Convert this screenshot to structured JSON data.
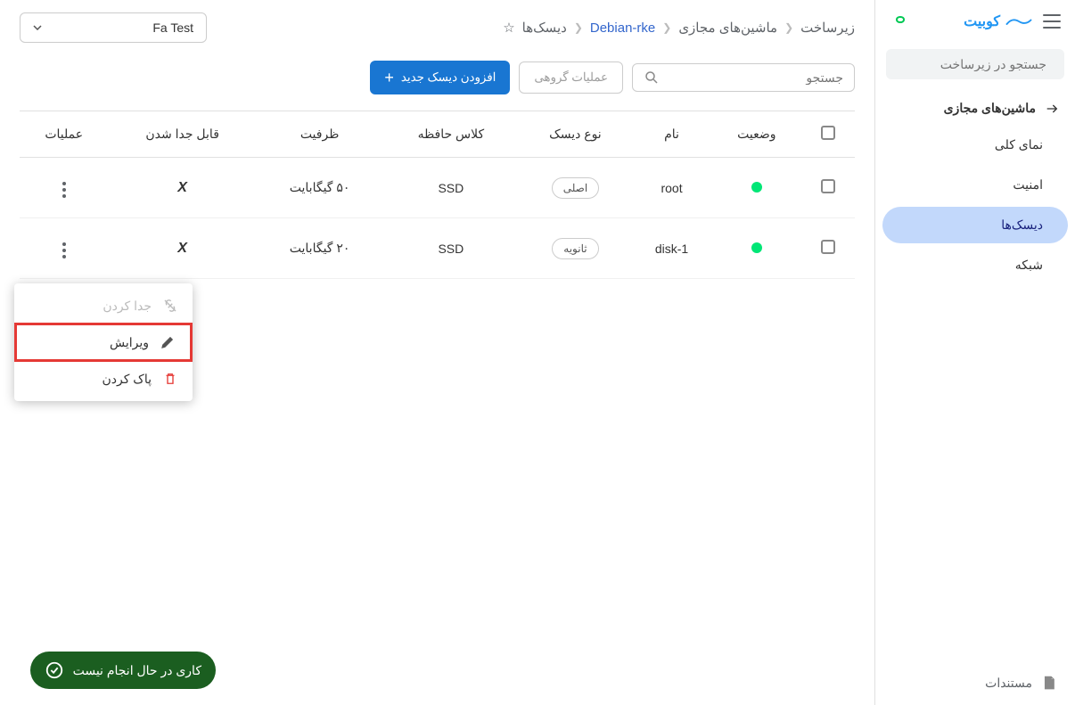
{
  "brand": {
    "name": "کوبیت"
  },
  "sidebar": {
    "search_placeholder": "جستجو در زیرساخت",
    "nav_title": "ماشین‌های مجازی",
    "items": [
      {
        "label": "نمای کلی"
      },
      {
        "label": "امنیت"
      },
      {
        "label": "دیسک‌ها"
      },
      {
        "label": "شبکه"
      }
    ],
    "docs": "مستندات"
  },
  "breadcrumb": {
    "c0": "زیرساخت",
    "c1": "ماشین‌های مجازی",
    "c2": "Debian-rke",
    "c3": "دیسک‌ها"
  },
  "project_selector": {
    "label": "Fa Test"
  },
  "toolbar": {
    "search_placeholder": "جستجو",
    "bulk_label": "عملیات گروهی",
    "add_label": "افزودن دیسک جدید"
  },
  "table": {
    "headers": {
      "checkbox": "",
      "status": "وضعیت",
      "name": "نام",
      "type": "نوع دیسک",
      "class": "کلاس حافظه",
      "capacity": "ظرفیت",
      "detachable": "قابل جدا شدن",
      "ops": "عملیات"
    },
    "rows": [
      {
        "name": "root",
        "type": "اصلی",
        "class": "SSD",
        "capacity": "۵۰ گیگابایت"
      },
      {
        "name": "disk-1",
        "type": "ثانویه",
        "class": "SSD",
        "capacity": "۲۰ گیگابایت"
      }
    ]
  },
  "menu": {
    "detach": "جدا کردن",
    "edit": "ویرایش",
    "delete": "پاک کردن"
  },
  "status_bar": "کاری در حال انجام نیست"
}
